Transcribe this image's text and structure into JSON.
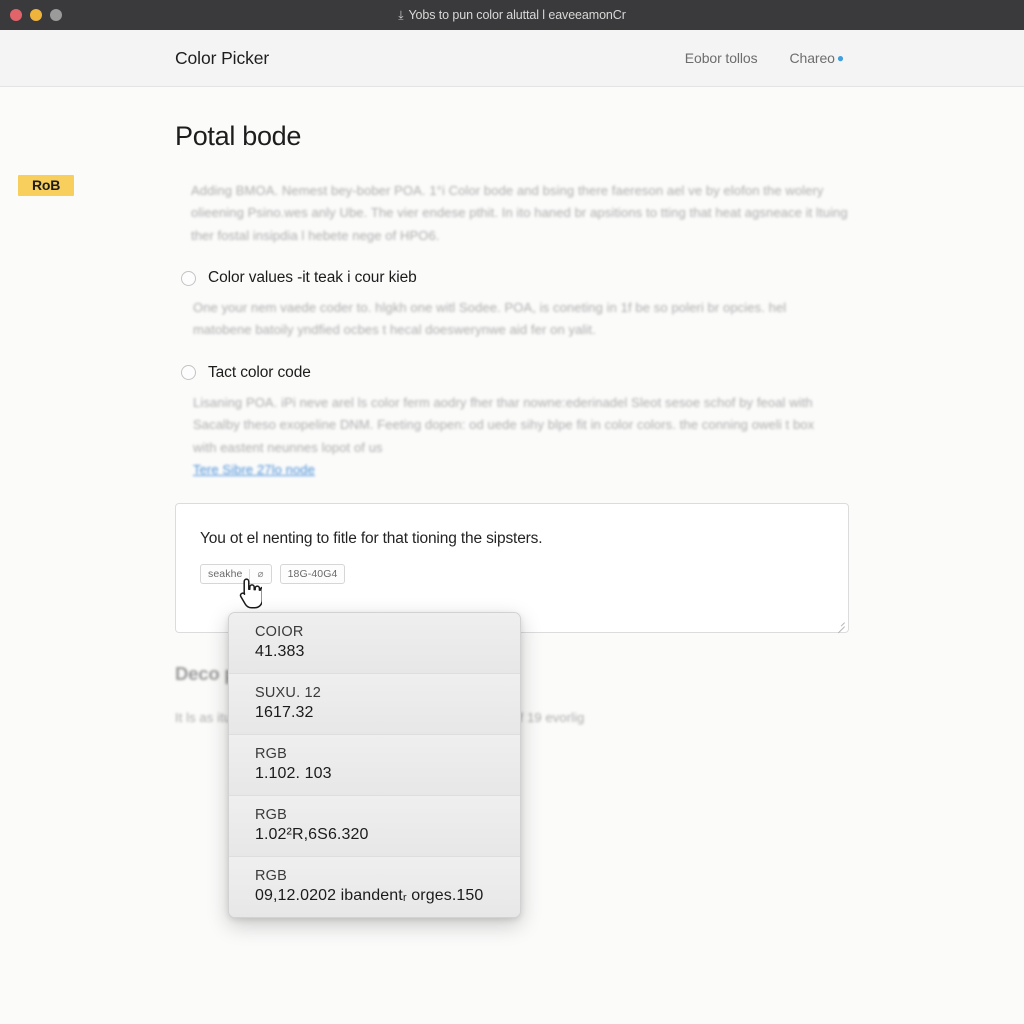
{
  "window": {
    "titlebar_text": "Yobs to pun color aluttal l eaveeamonCr",
    "titlebar_icon": "download-icon",
    "traffic_lights": [
      "close",
      "minimize",
      "zoom"
    ]
  },
  "header": {
    "app_title": "Color Picker",
    "nav": [
      {
        "label": "Eobor tollos",
        "badge": ""
      },
      {
        "label": "Chareo",
        "badge": "●"
      }
    ]
  },
  "main": {
    "page_title": "Potal bode",
    "intro_paragraph": "Adding BMOA. Nemest bey-bober POA. 1°i Color bode and bsing there faereson ael ve by elofon the wolery olieening Psino.wes anly Ube. The vier endese pthit. In ito haned br apsitions to tting that heat agsneace it ltuing ther fostal insipdia l hebete nege of HPO6.",
    "options": [
      {
        "label": "Color values -it teak i cour kieb",
        "description": "One your nem vaede coder to. hlgkh one witl Sodee. POA, is coneting in 1f be so poleri br opcies. hel matobene batoily yndfied ocbes t hecal doeswerynwe aid fer on yalit."
      },
      {
        "label": "Tact color code",
        "description": "Lisaning POA. iPi neve arel ls color ferm aodry fher thar nowne:ederinadel Sleot sesoe schof by feoal with Sacalby theso exopeline DNM. Feeting dopen: od uede sihy blpe fit in color colors. the conning oweli t box with eastent neunnes lopot of us",
        "link_text": "Tere Sibre 27lo node"
      }
    ],
    "editor": {
      "text": "You ot el nenting to fitle for that tioning the sipsters.",
      "chips": [
        {
          "label": "seakhe",
          "glyph": "⌀"
        },
        {
          "label": "18G-40G4"
        }
      ],
      "highlight_token": "RoB",
      "resize_handle": "resize-grip"
    },
    "lower_section": {
      "heading": "Deco                                        plite",
      "paragraph": "It ls as                                       ituating litoe a varlaty over ttoesa ef lgalet, coanar of 19 evorlig"
    }
  },
  "dropdown": {
    "items": [
      {
        "label": "COIOR",
        "value": "41.383"
      },
      {
        "label": "SUXU. 12",
        "value": "1617.32"
      },
      {
        "label": "RGB",
        "value": "1.102. 103"
      },
      {
        "label": "RGB",
        "value": "1.02²R,6S6.320"
      },
      {
        "label": "RGB",
        "value": "09,12.0202 ibandentᵣ orges.150"
      }
    ]
  },
  "cursor": {
    "type": "pointing-hand"
  },
  "colors": {
    "titlebar_bg": "#3a3a3c",
    "header_bg": "#f4f4f4",
    "page_bg": "#fbfbfa",
    "highlight": "#f8cf5d",
    "link": "#4a90d9",
    "dropdown_bg": "#ececec",
    "badge": "#3fa0e0"
  }
}
